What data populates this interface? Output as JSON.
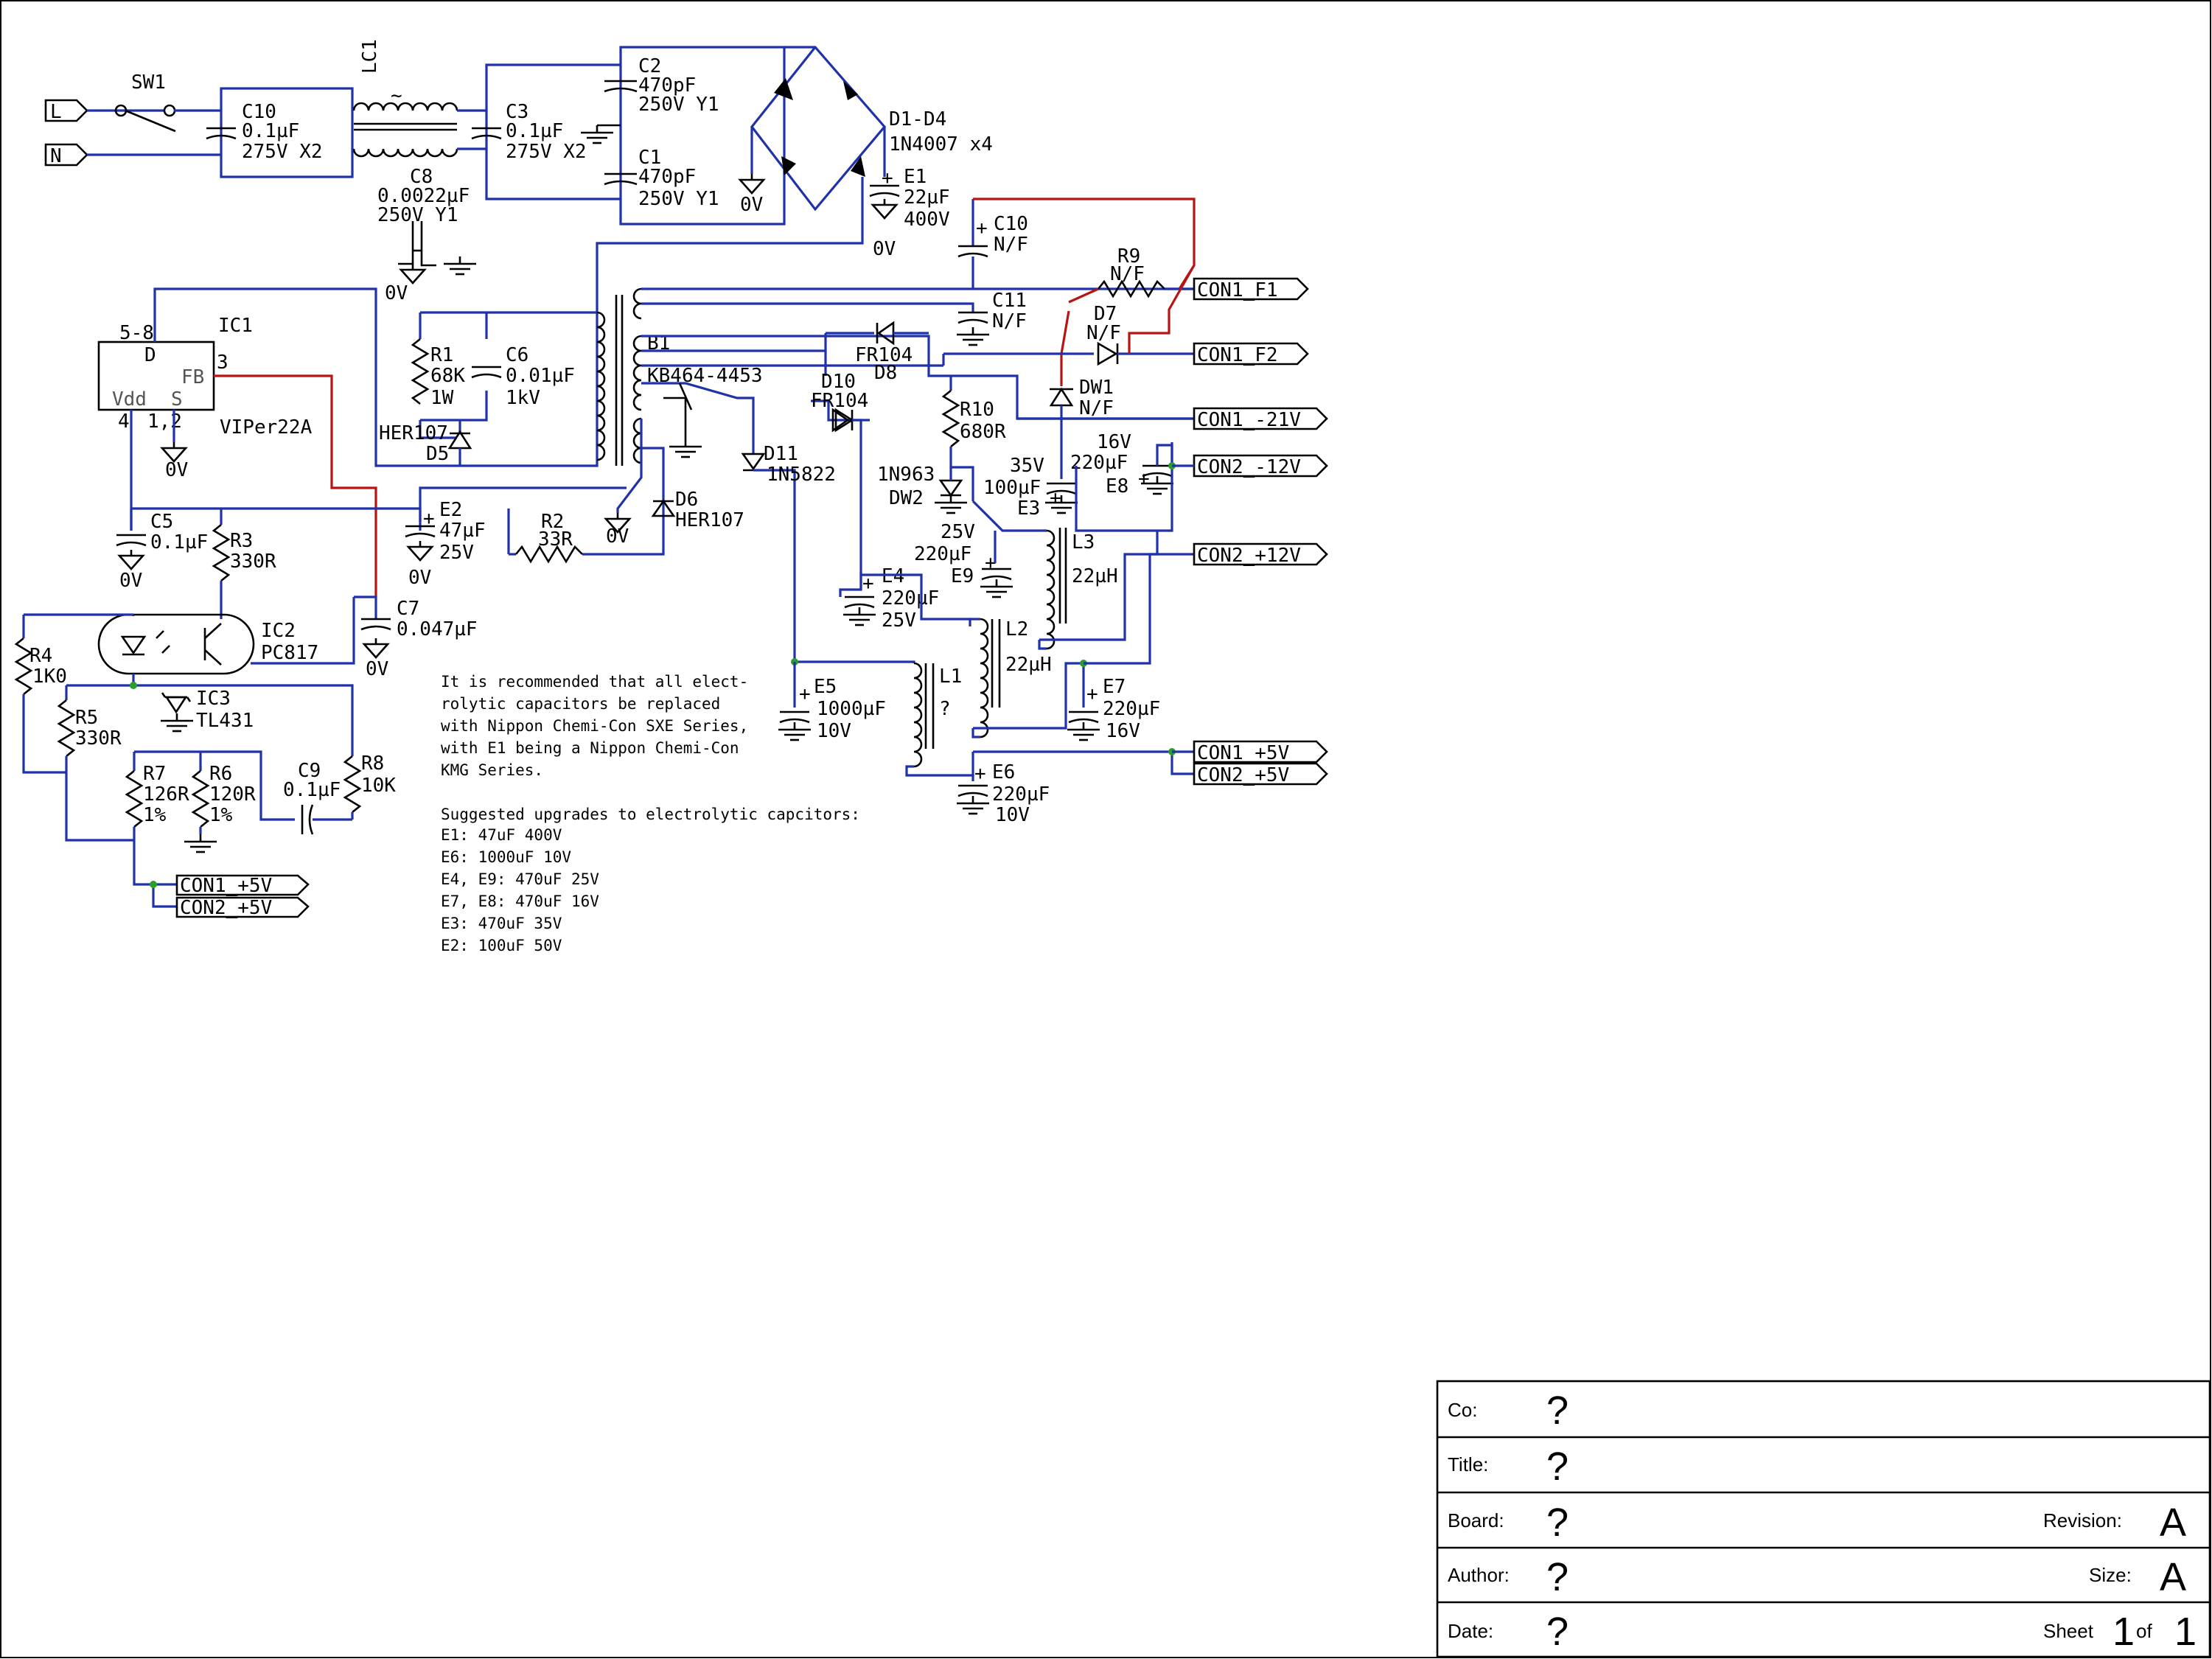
{
  "components": {
    "sw1": "SW1",
    "port_l": "L",
    "port_n": "N",
    "c10_top": [
      "C10",
      "0.1µF",
      "275V X2"
    ],
    "lc1": "LC1",
    "lc1_tilde": "~",
    "c3": [
      "C3",
      "0.1µF",
      "275V X2"
    ],
    "c2": [
      "C2",
      "470pF",
      "250V Y1"
    ],
    "c1": [
      "C1",
      "470pF",
      "250V Y1"
    ],
    "bridge": [
      "D1-D4",
      "1N4007 x4"
    ],
    "c8": [
      "C8",
      "0.0022µF",
      "250V Y1"
    ],
    "e1": [
      "E1",
      "22µF",
      "400V"
    ],
    "c10_nf": [
      "C10",
      "N/F"
    ],
    "c11_nf": [
      "C11",
      "N/F"
    ],
    "r9": [
      "R9",
      "N/F"
    ],
    "d7": [
      "D7",
      "N/F"
    ],
    "dw1": [
      "DW1",
      "N/F"
    ],
    "ic1": [
      "IC1",
      "5-8",
      "D",
      "FB",
      "3",
      "Vdd",
      "S",
      "4",
      "1,2",
      "VIPer22A"
    ],
    "r1": [
      "R1",
      "68K",
      "1W"
    ],
    "c6": [
      "C6",
      "0.01µF",
      "1kV"
    ],
    "d5": [
      "HER107",
      "D5"
    ],
    "b1": [
      "B1",
      "KB464-4453"
    ],
    "d8": [
      "FR104",
      "D8"
    ],
    "d10": [
      "D10",
      "FR104"
    ],
    "d11": [
      "D11",
      "1N5822"
    ],
    "d6": [
      "D6",
      "HER107"
    ],
    "r10": [
      "R10",
      "680R"
    ],
    "dw2": [
      "1N963",
      "DW2"
    ],
    "dw2_v": "25V",
    "e3": [
      "35V",
      "100µF",
      "E3"
    ],
    "e8": [
      "16V",
      "220µF",
      "E8"
    ],
    "e9": [
      "220µF",
      "E9"
    ],
    "e4": [
      "E4",
      "220µF",
      "25V"
    ],
    "l3": [
      "L3",
      "22µH"
    ],
    "l2": [
      "L2",
      "22µH"
    ],
    "l1": [
      "L1",
      "?"
    ],
    "e5": [
      "E5",
      "1000µF",
      "10V"
    ],
    "e7": [
      "E7",
      "220µF",
      "16V"
    ],
    "e6": [
      "E6",
      "220µF",
      "10V"
    ],
    "c5": [
      "C5",
      "0.1µF"
    ],
    "r3": [
      "R3",
      "330R"
    ],
    "e2": [
      "E2",
      "47µF",
      "25V"
    ],
    "r2": [
      "R2",
      "33R"
    ],
    "c7": [
      "C7",
      "0.047µF"
    ],
    "ic2": [
      "IC2",
      "PC817"
    ],
    "r4": [
      "R4",
      "1K0"
    ],
    "ic3": [
      "IC3",
      "TL431"
    ],
    "r5": [
      "R5",
      "330R"
    ],
    "r7": [
      "R7",
      "126R",
      "1%"
    ],
    "r6": [
      "R6",
      "120R",
      "1%"
    ],
    "c9": [
      "C9",
      "0.1µF"
    ],
    "r8": [
      "R8",
      "10K"
    ],
    "ground": "0V"
  },
  "connectors": {
    "f1": "CON1_F1",
    "f2": "CON1_F2",
    "m21": "CON1_-21V",
    "m12": "CON2_-12V",
    "p12": "CON2_+12V",
    "c1p5": "CON1_+5V",
    "c2p5": "CON2_+5V"
  },
  "note": {
    "lines": [
      "It is recommended that all elect-",
      "rolytic capacitors be replaced",
      "with Nippon Chemi-Con SXE Series,",
      "with E1 being a Nippon Chemi-Con",
      "KMG Series.",
      "",
      "Suggested upgrades to electrolytic capcitors:",
      "E1: 47uF 400V",
      "E6: 1000uF 10V",
      "E4, E9: 470uF 25V",
      "E7, E8: 470uF 16V",
      "E3: 470uF 35V",
      "E2: 100uF 50V"
    ]
  },
  "title_block": {
    "company_label": "Co:",
    "company_value": "?",
    "title_label": "Title:",
    "title_value": "?",
    "board_label": "Board:",
    "board_value": "?",
    "revision_label": "Revision:",
    "revision_value": "A",
    "author_label": "Author:",
    "author_value": "?",
    "size_label": "Size:",
    "size_value": "A",
    "date_label": "Date:",
    "date_value": "?",
    "sheet_label": "Sheet",
    "sheet_num": "1",
    "sheet_of": "of",
    "sheet_total": "1"
  }
}
